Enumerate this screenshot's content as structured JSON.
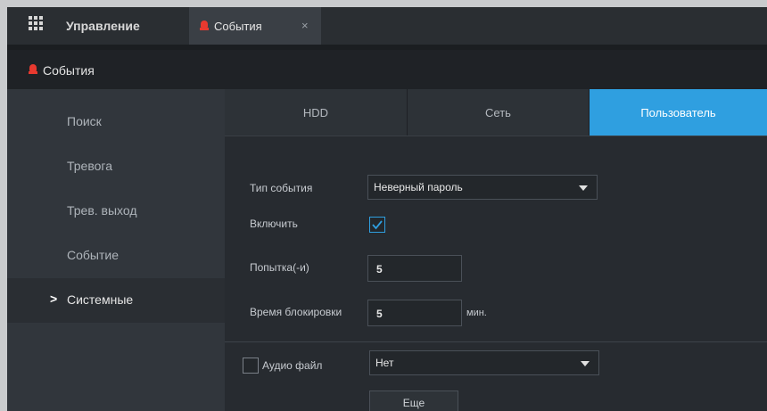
{
  "topbar": {
    "app_tab_label": "Управление",
    "events_tab_label": "События",
    "close_glyph": "×"
  },
  "header": {
    "title": "События"
  },
  "sidebar": {
    "items": [
      {
        "label": "Поиск",
        "active": false
      },
      {
        "label": "Тревога",
        "active": false
      },
      {
        "label": "Трев. выход",
        "active": false
      },
      {
        "label": "Событие",
        "active": false
      },
      {
        "label": "Системные",
        "active": true
      }
    ],
    "active_marker": ">"
  },
  "tabs": [
    {
      "label": "HDD",
      "active": false
    },
    {
      "label": "Сеть",
      "active": false
    },
    {
      "label": "Пользователь",
      "active": true
    }
  ],
  "form": {
    "event_type": {
      "label": "Тип события",
      "value": "Неверный пароль"
    },
    "enable": {
      "label": "Включить",
      "checked": true
    },
    "attempts": {
      "label": "Попытка(-и)",
      "value": "5"
    },
    "lock_time": {
      "label": "Время блокировки",
      "value": "5",
      "unit": "мин."
    },
    "audio": {
      "label": "Аудио файл",
      "checked": false,
      "value": "Нет"
    },
    "more_button": "Еще"
  },
  "colors": {
    "accent": "#2f9fe0",
    "alarm": "#e8392f"
  },
  "icons": {
    "app": "grid-icon",
    "events": "alarm-bell-icon",
    "check": "checkmark-icon"
  }
}
